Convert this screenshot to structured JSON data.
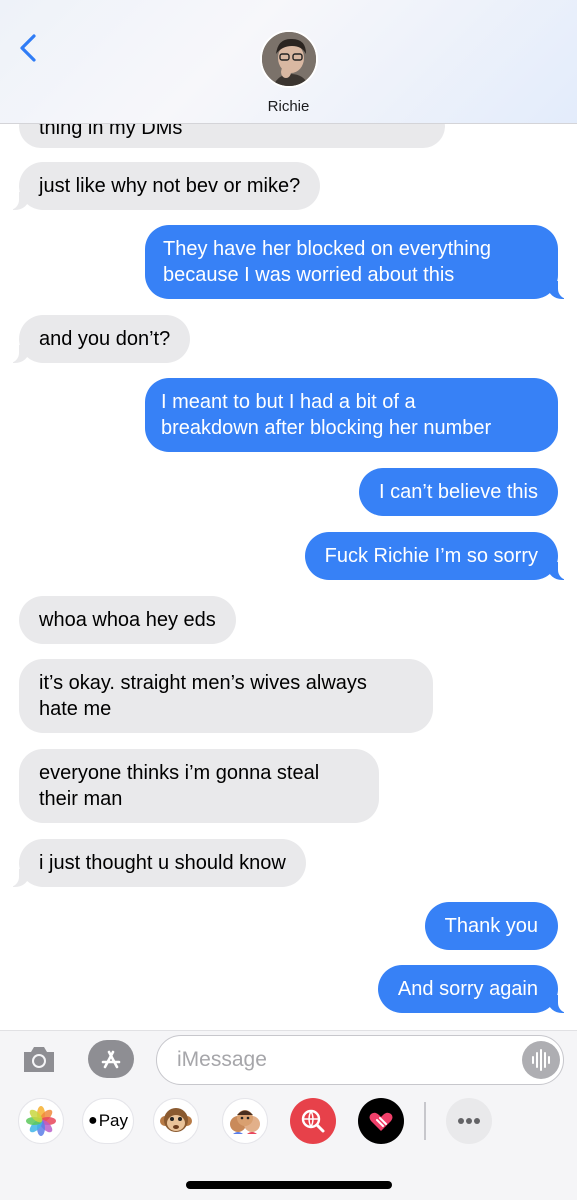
{
  "header": {
    "contact_name": "Richie"
  },
  "messages": [
    {
      "side": "received",
      "text": "thing in my DMs"
    },
    {
      "side": "received",
      "text": "just like why not bev or mike?"
    },
    {
      "side": "sent",
      "line1": "They have her blocked on everything",
      "line2": "because I was worried about this"
    },
    {
      "side": "received",
      "text": "and you don’t?"
    },
    {
      "side": "sent",
      "line1": "I meant to but I had a bit of a",
      "line2": "breakdown after blocking her number"
    },
    {
      "side": "sent",
      "text": "I can’t believe this"
    },
    {
      "side": "sent",
      "text": "Fuck Richie I’m so sorry"
    },
    {
      "side": "received",
      "text": "whoa whoa hey eds"
    },
    {
      "side": "received",
      "line1": "it’s okay. straight men’s wives always",
      "line2": "hate me"
    },
    {
      "side": "received",
      "line1": "everyone thinks i’m gonna steal",
      "line2": "their man"
    },
    {
      "side": "received",
      "text": "i just thought u should know"
    },
    {
      "side": "sent",
      "text": "Thank you"
    },
    {
      "side": "sent",
      "text": "And sorry again"
    }
  ],
  "compose": {
    "placeholder": "iMessage"
  },
  "apps": {
    "applepay_label": "Pay"
  },
  "colors": {
    "sent_bubble": "#3781f6",
    "received_bubble": "#e9e9eb",
    "accent": "#2f7cf6"
  }
}
